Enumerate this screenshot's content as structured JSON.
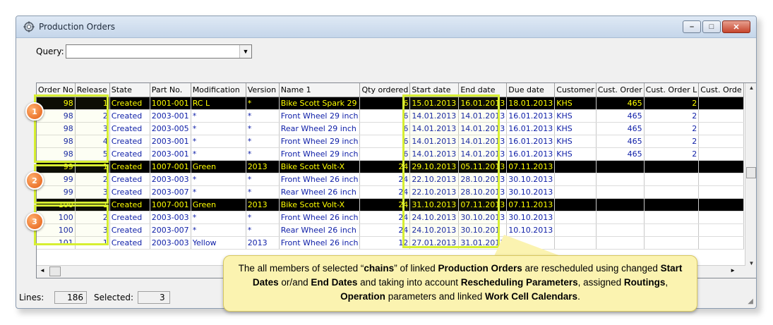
{
  "window": {
    "title": "Production Orders",
    "minimize_label": "–",
    "maximize_label": "□",
    "close_label": "✕"
  },
  "query": {
    "label": "Query:",
    "value": ""
  },
  "columns": [
    "Order No",
    "Release",
    "State",
    "Part No.",
    "Modification",
    "Version",
    "Name 1",
    "Qty ordered",
    "Start date",
    "End date",
    "Due date",
    "Customer",
    "Cust. Order",
    "Cust. Order L",
    "Cust. Orde"
  ],
  "rows": [
    {
      "order": "98",
      "release": "1",
      "state": "Created",
      "part": "1001-001",
      "mod": "RC L",
      "version": "*",
      "name": "Bike Scott Spark 29",
      "qty": "6",
      "start": "15.01.2013",
      "end": "16.01.2013",
      "due": "18.01.2013",
      "customer": "KHS",
      "cust_order": "465",
      "cust_order_l": "2",
      "cust_orde": "",
      "selected": true
    },
    {
      "order": "98",
      "release": "2",
      "state": "Created",
      "part": "2003-001",
      "mod": "*",
      "version": "*",
      "name": "Front Wheel 29 inch",
      "qty": "6",
      "start": "14.01.2013",
      "end": "14.01.2013",
      "due": "16.01.2013",
      "customer": "KHS",
      "cust_order": "465",
      "cust_order_l": "2",
      "cust_orde": "",
      "selected": false
    },
    {
      "order": "98",
      "release": "3",
      "state": "Created",
      "part": "2003-005",
      "mod": "*",
      "version": "*",
      "name": "Rear Wheel 29 inch",
      "qty": "6",
      "start": "14.01.2013",
      "end": "14.01.2013",
      "due": "16.01.2013",
      "customer": "KHS",
      "cust_order": "465",
      "cust_order_l": "2",
      "cust_orde": "",
      "selected": false
    },
    {
      "order": "98",
      "release": "4",
      "state": "Created",
      "part": "2003-001",
      "mod": "*",
      "version": "*",
      "name": "Front Wheel 29 inch",
      "qty": "6",
      "start": "14.01.2013",
      "end": "14.01.2013",
      "due": "16.01.2013",
      "customer": "KHS",
      "cust_order": "465",
      "cust_order_l": "2",
      "cust_orde": "",
      "selected": false
    },
    {
      "order": "98",
      "release": "5",
      "state": "Created",
      "part": "2003-001",
      "mod": "*",
      "version": "*",
      "name": "Front Wheel 29 inch",
      "qty": "6",
      "start": "14.01.2013",
      "end": "14.01.2013",
      "due": "16.01.2013",
      "customer": "KHS",
      "cust_order": "465",
      "cust_order_l": "2",
      "cust_orde": "",
      "selected": false
    },
    {
      "order": "99",
      "release": "1",
      "state": "Created",
      "part": "1007-001",
      "mod": "Green",
      "version": "2013",
      "name": "Bike Scott Volt-X",
      "qty": "24",
      "start": "29.10.2013",
      "end": "05.11.2013",
      "due": "07.11.2013",
      "customer": "",
      "cust_order": "",
      "cust_order_l": "",
      "cust_orde": "",
      "selected": true
    },
    {
      "order": "99",
      "release": "2",
      "state": "Created",
      "part": "2003-003",
      "mod": "*",
      "version": "*",
      "name": "Front Wheel 26 inch",
      "qty": "24",
      "start": "22.10.2013",
      "end": "28.10.2013",
      "due": "30.10.2013",
      "customer": "",
      "cust_order": "",
      "cust_order_l": "",
      "cust_orde": "",
      "selected": false
    },
    {
      "order": "99",
      "release": "3",
      "state": "Created",
      "part": "2003-007",
      "mod": "*",
      "version": "*",
      "name": "Rear Wheel 26 inch",
      "qty": "24",
      "start": "22.10.2013",
      "end": "28.10.2013",
      "due": "30.10.2013",
      "customer": "",
      "cust_order": "",
      "cust_order_l": "",
      "cust_orde": "",
      "selected": false
    },
    {
      "order": "100",
      "release": "1",
      "state": "Created",
      "part": "1007-001",
      "mod": "Green",
      "version": "2013",
      "name": "Bike Scott Volt-X",
      "qty": "24",
      "start": "31.10.2013",
      "end": "07.11.2013",
      "due": "07.11.2013",
      "customer": "",
      "cust_order": "",
      "cust_order_l": "",
      "cust_orde": "",
      "selected": true
    },
    {
      "order": "100",
      "release": "2",
      "state": "Created",
      "part": "2003-003",
      "mod": "*",
      "version": "*",
      "name": "Front Wheel 26 inch",
      "qty": "24",
      "start": "24.10.2013",
      "end": "30.10.2013",
      "due": "30.10.2013",
      "customer": "",
      "cust_order": "",
      "cust_order_l": "",
      "cust_orde": "",
      "selected": false
    },
    {
      "order": "100",
      "release": "3",
      "state": "Created",
      "part": "2003-007",
      "mod": "*",
      "version": "*",
      "name": "Rear Wheel 26 inch",
      "qty": "24",
      "start": "24.10.2013",
      "end": "30.10.201",
      "due": "10.10.2013",
      "customer": "",
      "cust_order": "",
      "cust_order_l": "",
      "cust_orde": "",
      "selected": false
    },
    {
      "order": "101",
      "release": "1",
      "state": "Created",
      "part": "2003-003",
      "mod": "Yellow",
      "version": "2013",
      "name": "Front Wheel 26 inch",
      "qty": "12",
      "start": "27.01.2013",
      "end": "31.01.2013",
      "due": "",
      "customer": "",
      "cust_order": "",
      "cust_order_l": "",
      "cust_orde": "",
      "selected": false
    }
  ],
  "status": {
    "lines_label": "Lines:",
    "lines_value": "186",
    "selected_label": "Selected:",
    "selected_value": "3"
  },
  "markers": [
    "1",
    "2",
    "3"
  ],
  "callout": {
    "parts": [
      {
        "t": "The all members of selected “",
        "b": false
      },
      {
        "t": "chains",
        "b": true
      },
      {
        "t": "” of linked ",
        "b": false
      },
      {
        "t": "Production Orders",
        "b": true
      },
      {
        "t": " are rescheduled using changed ",
        "b": false
      },
      {
        "t": "Start Dates",
        "b": true
      },
      {
        "t": " or/and ",
        "b": false
      },
      {
        "t": "End Dates",
        "b": true
      },
      {
        "t": " and taking into account ",
        "b": false
      },
      {
        "t": "Rescheduling Parameters",
        "b": true
      },
      {
        "t": ", assigned ",
        "b": false
      },
      {
        "t": "Routings",
        "b": true
      },
      {
        "t": ", ",
        "b": false
      },
      {
        "t": "Operation",
        "b": true
      },
      {
        "t": " parameters and linked ",
        "b": false
      },
      {
        "t": "Work Cell Calendars",
        "b": true
      },
      {
        "t": ".",
        "b": false
      }
    ]
  },
  "colors": {
    "highlight": "#d7ef32",
    "marker": "#e35b10",
    "callout_bg": "#fbf3b0",
    "selected_row_bg": "#000000",
    "selected_row_text": "#ffff00",
    "row_text": "#1020a8"
  }
}
